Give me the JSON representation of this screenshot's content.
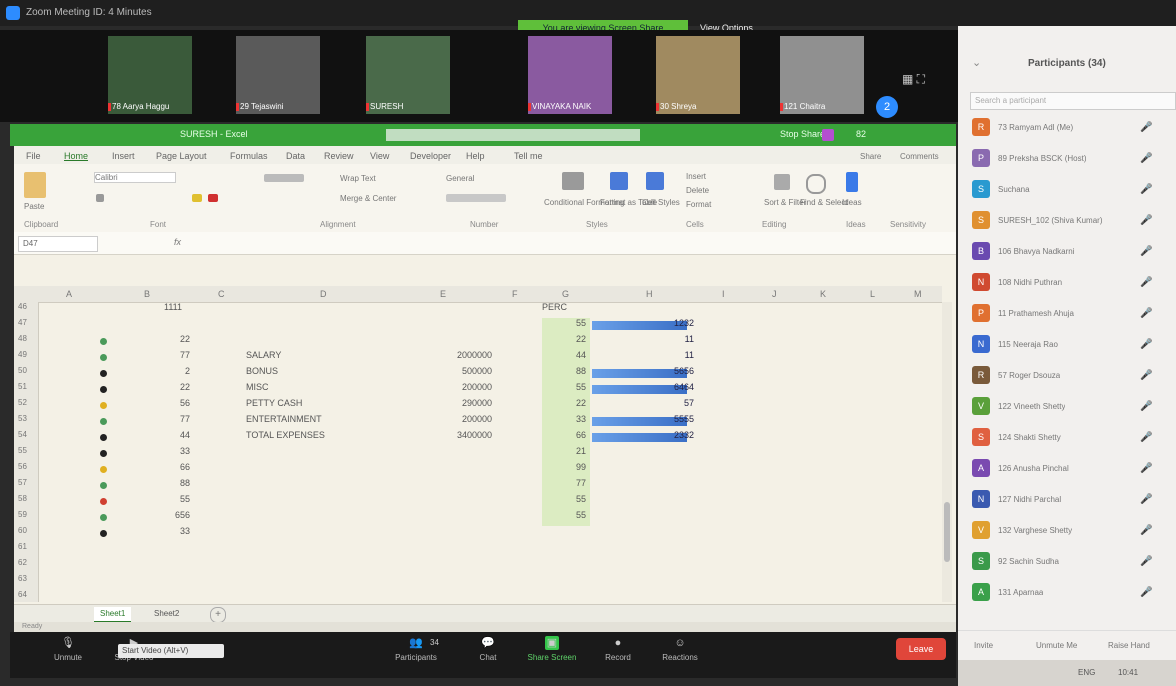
{
  "window": {
    "title": "Zoom Meeting ID: 4 Minutes"
  },
  "banner": {
    "sharing": "You are viewing Screen Share",
    "view_options": "View Options"
  },
  "gallery": {
    "tiles": [
      {
        "name": "78 Aarya Haggu",
        "color": "#3a5a3a"
      },
      {
        "name": "29 Tejaswini",
        "color": "#5a5a5a"
      },
      {
        "name": "SURESH",
        "color": "#4a6a4a"
      },
      {
        "name": "VINAYAKA NAIK",
        "color": "#8a5aa0"
      },
      {
        "name": "30 Shreya",
        "color": "#a08a60"
      },
      {
        "name": "121 Chaitra",
        "color": "#909090"
      }
    ],
    "view_label": "▦ ⛶",
    "next": "2"
  },
  "sharebar": {
    "label": "SURESH - Excel",
    "right_label": "Stop Share",
    "right_code": "82"
  },
  "excel": {
    "menu": [
      "File",
      "Home",
      "Insert",
      "Page Layout",
      "Formulas",
      "Data",
      "Review",
      "View",
      "Developer",
      "Help",
      "Tell me"
    ],
    "ribbon_groups": [
      "Clipboard",
      "Font",
      "Alignment",
      "Number",
      "Styles",
      "Cells",
      "Editing",
      "Ideas",
      "Sensitivity"
    ],
    "ribbon_labels": {
      "paste": "Paste",
      "font": "Calibri",
      "wrap": "Wrap Text",
      "merge": "Merge & Center",
      "general": "General",
      "cond": "Conditional Formatting",
      "fmt_table": "Format as Table",
      "cell_styles": "Cell Styles",
      "insert": "Insert",
      "delete": "Delete",
      "format": "Format",
      "sort": "Sort & Filter",
      "find": "Find & Select",
      "ideas": "Ideas",
      "share": "Share",
      "comments": "Comments"
    },
    "name_box": "D47",
    "formula": "fx",
    "columns": [
      "A",
      "B",
      "C",
      "D",
      "E",
      "F",
      "G",
      "H",
      "I",
      "J",
      "K",
      "L",
      "M"
    ],
    "rows": [
      "46",
      "47",
      "48",
      "49",
      "50",
      "51",
      "52",
      "53",
      "54",
      "55",
      "56",
      "57",
      "58",
      "59",
      "60",
      "61",
      "62",
      "63",
      "64"
    ],
    "top_cells": {
      "b46": "1111",
      "g46": "PERC"
    },
    "b_values": [
      "22",
      "77",
      "2",
      "22",
      "56",
      "77",
      "44",
      "33",
      "66",
      "88",
      "55",
      "656",
      "33"
    ],
    "dot_colors": [
      "#4a9a5a",
      "#4a9a5a",
      "#222222",
      "#222222",
      "#e0b020",
      "#4a9a5a",
      "#222222",
      "#222222",
      "#e0b020",
      "#4a9a5a",
      "#d04030",
      "#4a9a5a",
      "#222222"
    ],
    "labels": [
      "SALARY",
      "BONUS",
      "MISC",
      "PETTY CASH",
      "ENTERTAINMENT",
      "TOTAL EXPENSES"
    ],
    "amounts": [
      "2000000",
      "500000",
      "200000",
      "290000",
      "200000",
      "3400000"
    ],
    "g_values": [
      "55",
      "22",
      "44",
      "88",
      "55",
      "22",
      "33",
      "66",
      "21",
      "99",
      "77",
      "55",
      "55"
    ],
    "h_values": [
      "1232",
      "11",
      "11",
      "5656",
      "6464",
      "57",
      "5555",
      "2332"
    ],
    "h_bar_levels": [
      0.95,
      0.0,
      0.0,
      0.95,
      0.95,
      0.0,
      0.95,
      0.95
    ],
    "sheets": [
      "Sheet1",
      "Sheet2"
    ],
    "add_sheet": "+",
    "status_left": "Ready"
  },
  "toolbar": {
    "items": [
      "Unmute",
      "Stop Video",
      "Participants",
      "Chat",
      "Share Screen",
      "Record",
      "Reactions"
    ],
    "participants_count": "34",
    "leave": "Leave",
    "tooltip": "Start Video (Alt+V)"
  },
  "participants": {
    "title": "Participants (34)",
    "search_placeholder": "Search a participant",
    "list": [
      {
        "name": "73 Ramyam Adl (Me)",
        "color": "#e07030",
        "initial": "R"
      },
      {
        "name": "89 Preksha BSCK (Host)",
        "color": "#8a6ab0",
        "initial": "P"
      },
      {
        "name": "Suchana",
        "color": "#2a9ad0",
        "initial": "S"
      },
      {
        "name": "SURESH_102 (Shiva Kumar)",
        "color": "#e09030",
        "initial": "S"
      },
      {
        "name": "106 Bhavya Nadkarni",
        "color": "#6a4ab0",
        "initial": "B"
      },
      {
        "name": "108 Nidhi Puthran",
        "color": "#d04a30",
        "initial": "N"
      },
      {
        "name": "11 Prathamesh Ahuja",
        "color": "#e07030",
        "initial": "P"
      },
      {
        "name": "115 Neeraja Rao",
        "color": "#3a6ad0",
        "initial": "N"
      },
      {
        "name": "57 Roger Dsouza",
        "color": "#7a5a3a",
        "initial": "R"
      },
      {
        "name": "122 Vineeth Shetty",
        "color": "#5aa03a",
        "initial": "V"
      },
      {
        "name": "124 Shakti Shetty",
        "color": "#e06040",
        "initial": "S"
      },
      {
        "name": "126 Anusha Pinchal",
        "color": "#7a4ab0",
        "initial": "A"
      },
      {
        "name": "127 Nidhi Parchal",
        "color": "#3a5ab0",
        "initial": "N"
      },
      {
        "name": "132 Varghese Shetty",
        "color": "#e0a030",
        "initial": "V"
      },
      {
        "name": "92 Sachin Sudha",
        "color": "#3a9a4a",
        "initial": "S"
      },
      {
        "name": "131 Aparnaa",
        "color": "#3aa04a",
        "initial": "A"
      }
    ],
    "mic_icon": "🎤",
    "footer": [
      "Invite",
      "Unmute Me",
      "Raise Hand"
    ]
  },
  "taskbar": {
    "items": [
      "ENG",
      "10:41"
    ]
  }
}
